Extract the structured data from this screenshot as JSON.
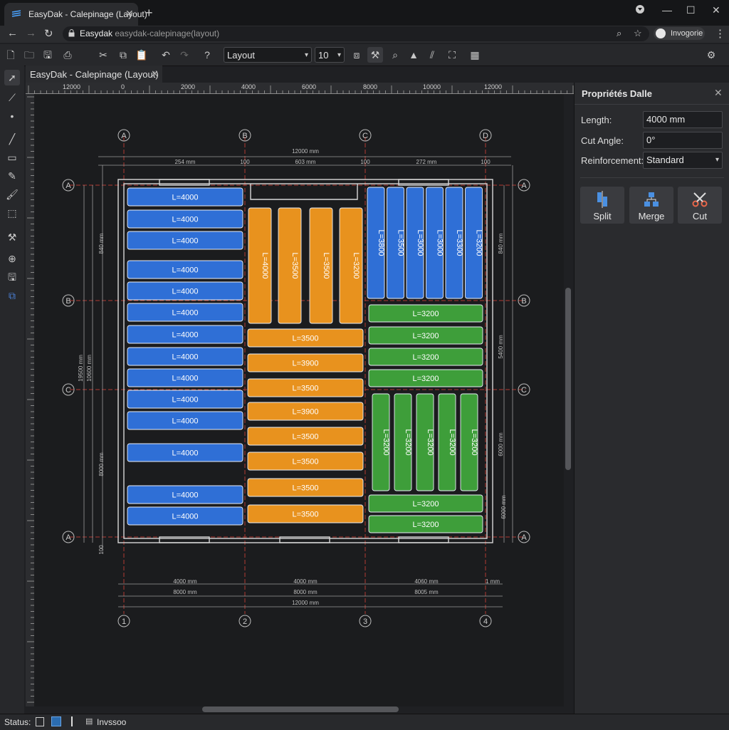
{
  "browser": {
    "tab_title": "EasyDak - Calepinage (Layout)",
    "address_domain": "Easydak",
    "address_path": "easydak-calepinage(layout)",
    "profile_name": "Invogorie"
  },
  "toolbar": {
    "view_select": "Layout",
    "size_select": "10"
  },
  "document_tab": "EasyDak - Calepinage (Layout)",
  "ruler": {
    "marks": [
      "12000",
      "0",
      "2000",
      "4000",
      "6000",
      "8000",
      "10000",
      "12000"
    ]
  },
  "drawing": {
    "grid_letters_top": [
      "A",
      "B",
      "C",
      "D"
    ],
    "grid_letters_left": [
      "A",
      "B",
      "C",
      "A"
    ],
    "grid_letters_right": [
      "A",
      "B",
      "C",
      "A"
    ],
    "grid_numbers_bottom": [
      "1",
      "2",
      "3",
      "4"
    ],
    "top_dim_total": "12000 mm",
    "top_dims": [
      "254 mm",
      "100",
      "603 mm",
      "100",
      "272 mm",
      "100"
    ],
    "bottom_dims_row1": [
      "4000 mm",
      "4000 mm",
      "4060 mm",
      "1 mm"
    ],
    "bottom_dims_row2": [
      "8000 mm",
      "8000 mm",
      "8005 mm"
    ],
    "bottom_dim_total": "12000 mm",
    "left_dims": [
      "840 mm",
      "19500 mm",
      "10600 mm",
      "8000 mm",
      "100"
    ],
    "right_dims": [
      "840 mm",
      "5400 mm",
      "6000 mm",
      "6000 mm"
    ],
    "panels_blue_left": [
      "L=4000",
      "L=4000",
      "L=4000",
      "L=4000",
      "L=4000",
      "L=4000",
      "L=4000",
      "L=4000",
      "L=4000",
      "L=4000",
      "L=4000",
      "L=4000",
      "L=4000",
      "L=4000"
    ],
    "panels_orange_vertical": [
      "L=4000",
      "L=3500",
      "L=3500",
      "L=3200"
    ],
    "panels_orange_horizontal": [
      "L=3500",
      "L=3900",
      "L=3500",
      "L=3900",
      "L=3500",
      "L=3500",
      "L=3500",
      "L=3500"
    ],
    "panels_blue_vertical": [
      "L=3800",
      "L=3500",
      "L=3000",
      "L=3000",
      "L=3300",
      "L=3200"
    ],
    "panels_green_upper": [
      "L=3200",
      "L=3200",
      "L=3200",
      "L=3200"
    ],
    "panels_green_vertical": [
      "L=3200",
      "L=3200",
      "L=3200",
      "L=3200",
      "L=3200"
    ],
    "panels_green_lower": [
      "L=3200",
      "L=3200"
    ]
  },
  "panel": {
    "title": "Propriétés Dalle",
    "length_label": "Length:",
    "length_value": "4000 mm",
    "cut_angle_label": "Cut Angle:",
    "cut_angle_value": "0°",
    "reinforcement_label": "Reinforcement:",
    "reinforcement_value": "Standard",
    "split_label": "Split",
    "merge_label": "Merge",
    "cut_label": "Cut"
  },
  "status": {
    "label": "Status:",
    "mode": "Invssoo"
  },
  "colors": {
    "blue": "#2f6fd6",
    "orange": "#e8921e",
    "green": "#3e9e3a",
    "accent_red": "#c0392b"
  }
}
